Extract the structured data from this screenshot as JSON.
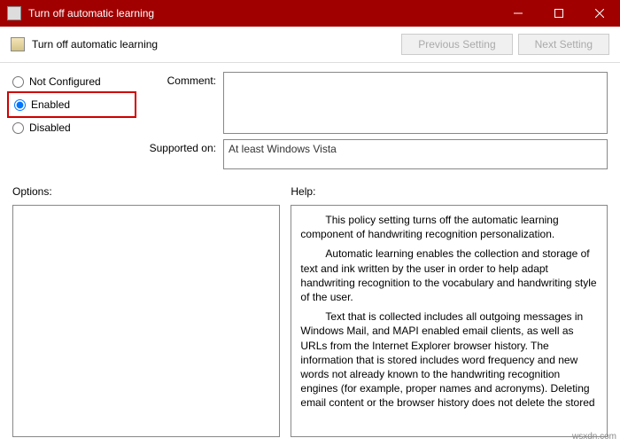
{
  "titlebar": {
    "title": "Turn off automatic learning"
  },
  "toolbar": {
    "page_title": "Turn off automatic learning",
    "prev": "Previous Setting",
    "next": "Next Setting"
  },
  "radios": {
    "not_configured": "Not Configured",
    "enabled": "Enabled",
    "disabled": "Disabled"
  },
  "labels": {
    "comment": "Comment:",
    "supported": "Supported on:",
    "options": "Options:",
    "help": "Help:"
  },
  "supported_text": "At least Windows Vista",
  "help_p1": "This policy setting turns off the automatic learning component of handwriting recognition personalization.",
  "help_p2": "Automatic learning enables the collection and storage of text and ink written by the user in order to help adapt handwriting recognition to the vocabulary and handwriting style of the user.",
  "help_p3": "Text that is collected includes all outgoing messages in Windows Mail, and MAPI enabled email clients, as well as URLs from the Internet Explorer browser history. The information that is stored includes word frequency and new words not already known to the handwriting recognition engines (for example, proper names and acronyms). Deleting email content or the browser history does not delete the stored",
  "watermark": "wsxdn.com"
}
